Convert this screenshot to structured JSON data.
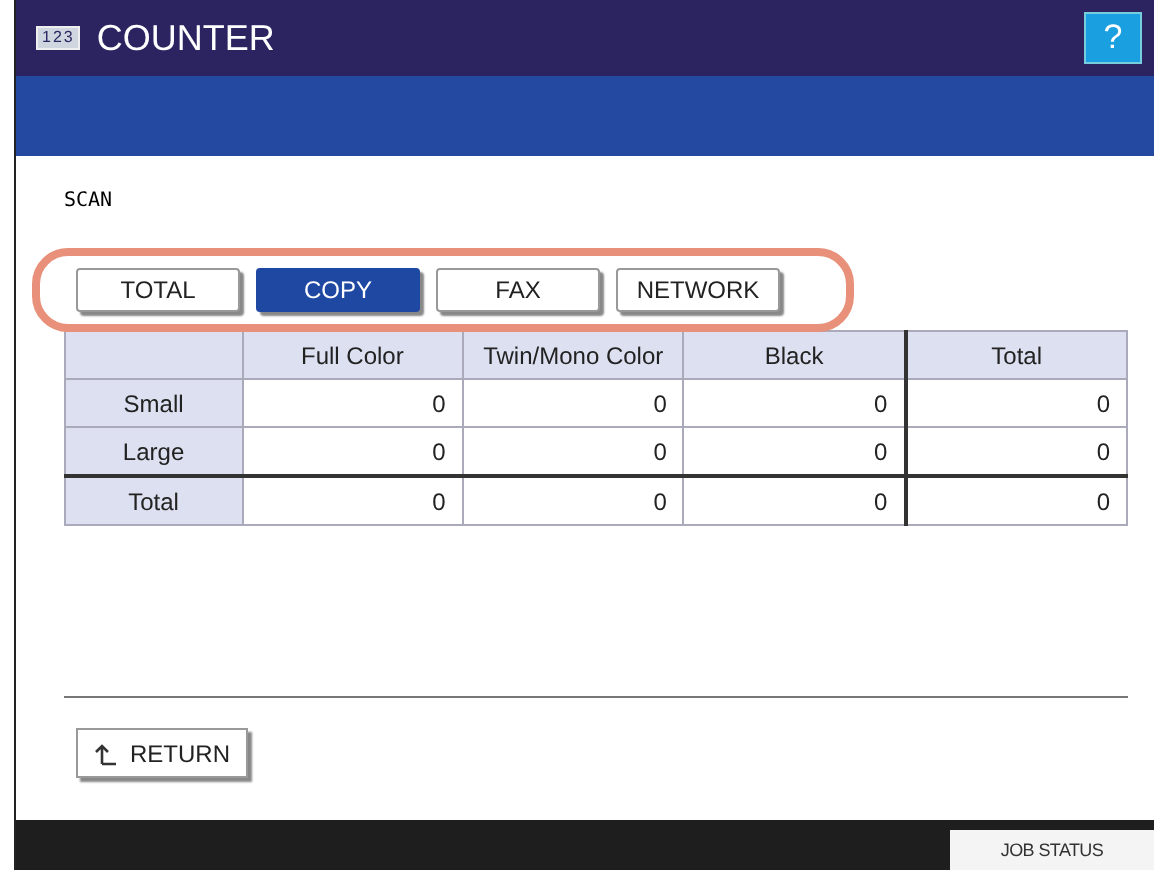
{
  "window": {
    "icon_label": "123",
    "title": "COUNTER",
    "help": "?"
  },
  "section_label": "SCAN",
  "tabs": [
    {
      "label": "TOTAL",
      "selected": false
    },
    {
      "label": "COPY",
      "selected": true
    },
    {
      "label": "FAX",
      "selected": false
    },
    {
      "label": "NETWORK",
      "selected": false
    }
  ],
  "table": {
    "columns": [
      "",
      "Full Color",
      "Twin/Mono Color",
      "Black",
      "Total"
    ],
    "rows": [
      {
        "cells": [
          "Small",
          "0",
          "0",
          "0",
          "0"
        ]
      },
      {
        "cells": [
          "Large",
          "0",
          "0",
          "0",
          "0"
        ]
      },
      {
        "cells": [
          "Total",
          "0",
          "0",
          "0",
          "0"
        ]
      }
    ]
  },
  "return_button": "RETURN",
  "status_bar": {
    "job_status": "JOB STATUS"
  }
}
